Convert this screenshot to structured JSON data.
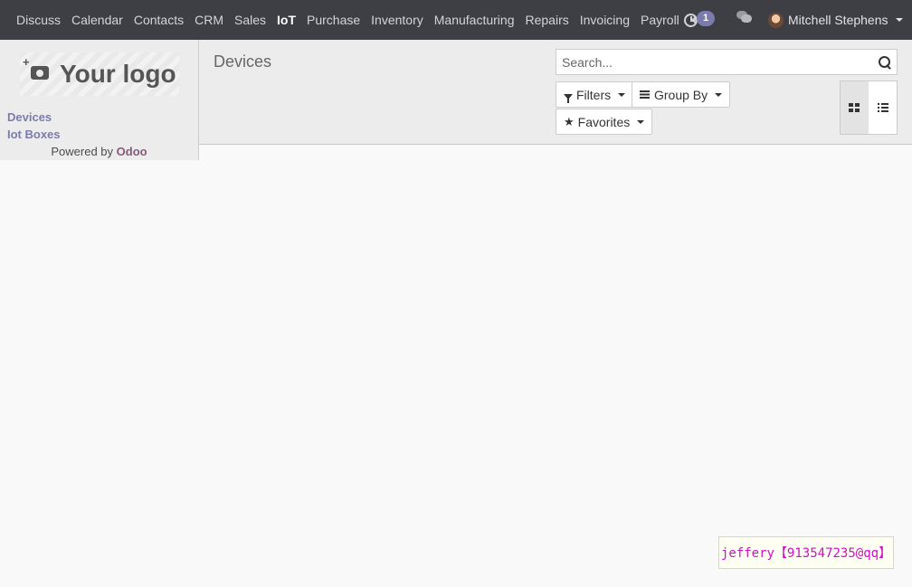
{
  "navbar": {
    "apps": [
      {
        "label": "Discuss",
        "active": false
      },
      {
        "label": "Calendar",
        "active": false
      },
      {
        "label": "Contacts",
        "active": false
      },
      {
        "label": "CRM",
        "active": false
      },
      {
        "label": "Sales",
        "active": false
      },
      {
        "label": "IoT",
        "active": true
      },
      {
        "label": "Purchase",
        "active": false
      },
      {
        "label": "Inventory",
        "active": false
      },
      {
        "label": "Manufacturing",
        "active": false
      },
      {
        "label": "Repairs",
        "active": false
      },
      {
        "label": "Invoicing",
        "active": false
      },
      {
        "label": "Payroll",
        "active": false
      }
    ],
    "more_label": "+",
    "activity_count": "1",
    "user_name": "Mitchell Stephens",
    "icons": {
      "activity": "clock-icon",
      "messages": "chat-icon",
      "more": "plus-icon"
    }
  },
  "sidebar": {
    "logo_text": "Your logo",
    "menu": [
      "Devices",
      "Iot Boxes"
    ],
    "powered_by": "Powered by",
    "powered_brand": "Odoo"
  },
  "control_panel": {
    "breadcrumb": "Devices",
    "search_placeholder": "Search...",
    "filters_label": "Filters",
    "group_by_label": "Group By",
    "favorites_label": "Favorites",
    "active_view": "kanban"
  },
  "watermark": "jeffery【913547235@qq】",
  "colors": {
    "navbar": "#3d3f45",
    "accent": "#7c7bad",
    "brand": "#875a7b",
    "watermark": "#d010c8"
  }
}
